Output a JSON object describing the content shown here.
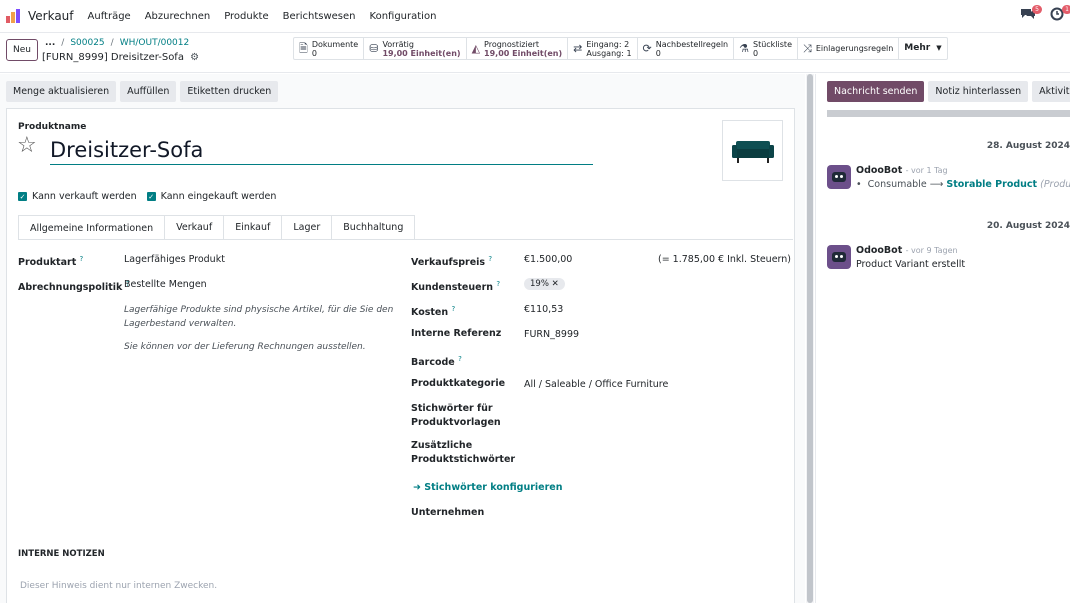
{
  "nav": {
    "app_name": "Verkauf",
    "menu": [
      "Aufträge",
      "Abzurechnen",
      "Produkte",
      "Berichtswesen",
      "Konfiguration"
    ],
    "chat_badge": "5",
    "activity_badge": "1"
  },
  "control": {
    "new_label": "Neu",
    "breadcrumb_ellipsis": "...",
    "breadcrumb": [
      "S00025",
      "WH/OUT/00012"
    ],
    "record_title": "[FURN_8999] Dreisitzer-Sofa",
    "smart_buttons": [
      {
        "icon": "document-icon",
        "label": "Dokumente",
        "value": "0"
      },
      {
        "icon": "cubes-icon",
        "label": "Vorrätig",
        "value": "19,00 Einheit(en)"
      },
      {
        "icon": "chart-area-icon",
        "label": "Prognostiziert",
        "value": "19,00 Einheit(en)"
      },
      {
        "icon": "exchange-icon",
        "label": "Eingang: 2",
        "value": "Ausgang: 1"
      },
      {
        "icon": "refresh-icon",
        "label": "Nachbestellregeln",
        "value": "0"
      },
      {
        "icon": "flask-icon",
        "label": "Stückliste",
        "value": "0"
      },
      {
        "icon": "random-icon",
        "label": "Einlagerungsregeln",
        "value": ""
      }
    ],
    "more_label": "Mehr"
  },
  "actions": [
    "Menge aktualisieren",
    "Auffüllen",
    "Etiketten drucken"
  ],
  "form": {
    "name_label": "Produktname",
    "name_value": "Dreisitzer-Sofa",
    "checkbox_sold": "Kann verkauft werden",
    "checkbox_purchased": "Kann eingekauft werden",
    "tabs": [
      "Allgemeine Informationen",
      "Verkauf",
      "Einkauf",
      "Lager",
      "Buchhaltung"
    ],
    "left_fields": {
      "produktart_label": "Produktart",
      "produktart_value": "Lagerfähiges Produkt",
      "abrechnung_label": "Abrechnungspolitik",
      "abrechnung_value": "Bestellte Mengen",
      "help1": "Lagerfähige Produkte sind physische Artikel, für die Sie den Lagerbestand verwalten.",
      "help2": "Sie können vor der Lieferung Rechnungen ausstellen."
    },
    "right_fields": {
      "verkaufspreis_label": "Verkaufspreis",
      "verkaufspreis_value": "€1.500,00",
      "verkaufspreis_incl": "(= 1.785,00 € Inkl. Steuern)",
      "kundensteuern_label": "Kundensteuern",
      "kundensteuern_tag": "19%",
      "kosten_label": "Kosten",
      "kosten_value": "€110,53",
      "interne_ref_label": "Interne Referenz",
      "interne_ref_value": "FURN_8999",
      "barcode_label": "Barcode",
      "kategorie_label": "Produktkategorie",
      "kategorie_value": "All / Saleable / Office Furniture",
      "stichwoerter_label": "Stichwörter für Produktvorlagen",
      "zusaetzliche_label": "Zusätzliche Produktstichwörter",
      "configure_link": "Stichwörter konfigurieren",
      "unternehmen_label": "Unternehmen"
    },
    "notes_title": "INTERNE NOTIZEN",
    "notes_placeholder": "Dieser Hinweis dient nur internen Zwecken."
  },
  "chatter": {
    "send_label": "Nachricht senden",
    "note_label": "Notiz hinterlassen",
    "activity_label": "Aktivitäten",
    "date1": "28. August 2024",
    "msg1_author": "OdooBot",
    "msg1_ago": "- vor 1 Tag",
    "msg1_old": "Consumable",
    "msg1_new": "Storable Product",
    "msg1_field": "(Produktart)",
    "date2": "20. August 2024",
    "msg2_author": "OdooBot",
    "msg2_ago": "- vor 9 Tagen",
    "msg2_body": "Product Variant erstellt"
  }
}
